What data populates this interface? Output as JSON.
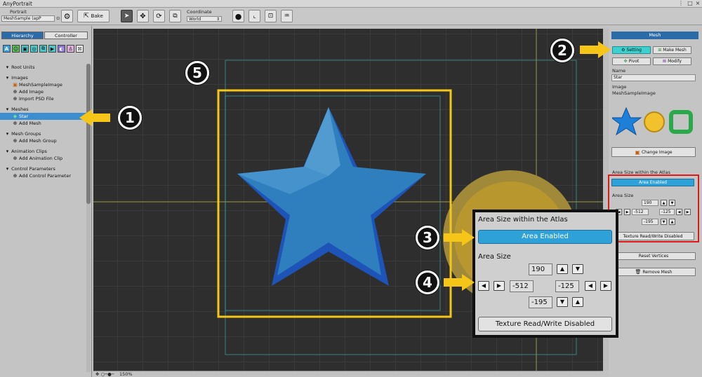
{
  "window": {
    "title": "AnyPortrait"
  },
  "toolbar": {
    "portrait_label": "Portrait",
    "portrait_value": "MeshSample (apP",
    "bake_label": "Bake",
    "coordinate_label": "Coordinate",
    "coordinate_value": "World"
  },
  "left_panel": {
    "tabs": [
      "Hierarchy",
      "Controller"
    ],
    "sections": {
      "root_units": "Root Units",
      "images": "Images",
      "images_items": [
        "MeshSampleImage",
        "Add Image",
        "Import PSD File"
      ],
      "meshes": "Meshes",
      "meshes_items": [
        "Star",
        "Add Mesh"
      ],
      "mesh_groups": "Mesh Groups",
      "mesh_groups_items": [
        "Add Mesh Group"
      ],
      "animation_clips": "Animation Clips",
      "animation_clips_items": [
        "Add Animation Clip"
      ],
      "control_parameters": "Control Parameters",
      "control_parameters_items": [
        "Add Control Parameter"
      ]
    }
  },
  "bottom_bar": {
    "zoom": "150%"
  },
  "right_panel": {
    "header": "Mesh",
    "buttons": {
      "setting": "Setting",
      "make_mesh": "Make Mesh",
      "pivot": "Pivot",
      "modify": "Modify"
    },
    "name_label": "Name",
    "name_value": "Star",
    "image_label": "Image",
    "image_value": "MeshSampleImage",
    "change_image": "Change Image",
    "area_title": "Area Size within the Atlas",
    "area_enabled": "Area Enabled",
    "area_size_label": "Area Size",
    "area_top": "190",
    "area_left": "-512",
    "area_right": "-125",
    "area_bottom": "-195",
    "texture_rw": "Texture Read/Write Disabled",
    "reset_vertices": "Reset Vertices",
    "remove_mesh": "Remove Mesh"
  },
  "callouts": [
    "1",
    "2",
    "3",
    "4",
    "5"
  ],
  "colors": {
    "accent": "#f5c518",
    "selection": "#3d8dd1",
    "area_button": "#2ea2d8",
    "canvas": "#2e2e2e",
    "setting_button": "#3ecfcf"
  }
}
